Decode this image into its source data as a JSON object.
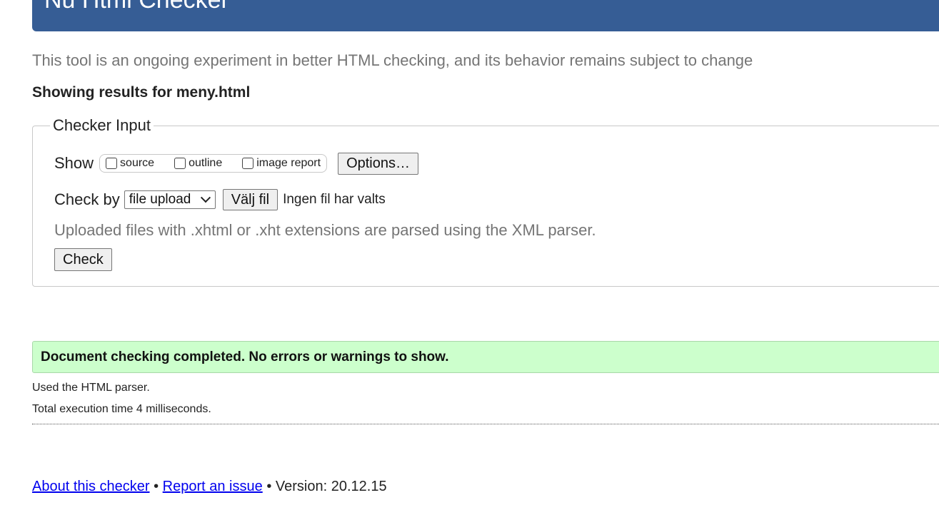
{
  "header": {
    "title": "Nu Html Checker"
  },
  "intro": "This tool is an ongoing experiment in better HTML checking, and its behavior remains subject to change",
  "results_heading": "Showing results for meny.html",
  "checker_input": {
    "legend": "Checker Input",
    "show_label": "Show",
    "show_options": [
      {
        "label": "source",
        "checked": false
      },
      {
        "label": "outline",
        "checked": false
      },
      {
        "label": "image report",
        "checked": false
      }
    ],
    "options_button": "Options…",
    "check_by_label": "Check by",
    "check_by_selected": "file upload",
    "file_button": "Välj fil",
    "file_status": "Ingen fil har valts",
    "hint": "Uploaded files with .xhtml or .xht extensions are parsed using the XML parser.",
    "check_button": "Check"
  },
  "result": {
    "message": "Document checking completed. No errors or warnings to show.",
    "parser_info": "Used the HTML parser.",
    "execution_time": "Total execution time 4 milliseconds.",
    "status_color": "#ccffcc"
  },
  "footer": {
    "about_link": "About this checker",
    "separator": "•",
    "report_link": "Report an issue",
    "version": "Version: 20.12.15"
  },
  "colors": {
    "header_bg": "#365d95",
    "link": "#0000ee"
  }
}
